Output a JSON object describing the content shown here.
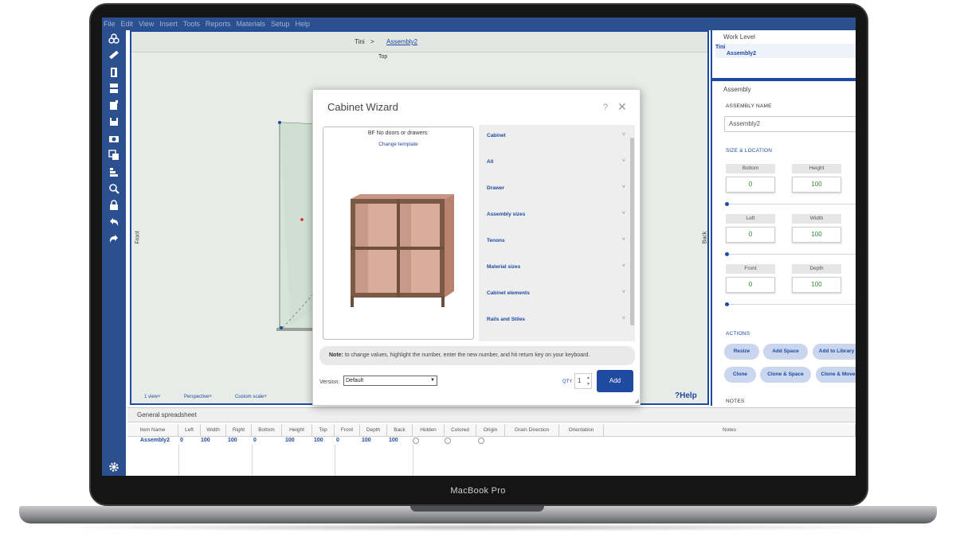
{
  "device": {
    "label": "MacBook Pro"
  },
  "menu": [
    "File",
    "Edit",
    "View",
    "Insert",
    "Tools",
    "Reports",
    "Materials",
    "Setup",
    "Help"
  ],
  "toolbar_icons": [
    "assembly-icon",
    "measure-icon",
    "door-icon",
    "drawer-icon",
    "panel-icon",
    "save-icon",
    "camera-icon",
    "copy-icon",
    "align-icon",
    "zoom-icon",
    "lock-icon",
    "undo-icon",
    "redo-icon"
  ],
  "settings_icon": "gear-icon",
  "viewport": {
    "breadcrumb_root": "Tini",
    "breadcrumb_sep": ">",
    "breadcrumb_current": "Assembly2",
    "top_label": "Top",
    "front_label": "Front",
    "back_label": "Back",
    "views": "1 view˅",
    "projection": "Perspective˅",
    "scale": "Custom scale˅",
    "help": "?Help"
  },
  "work_level": {
    "title": "Work Level",
    "root": "Tini",
    "child": "Assembly2"
  },
  "assembly": {
    "title": "Assembly",
    "name_label": "ASSEMBLY NAME",
    "name_value": "Assembly2",
    "size_label": "SIZE & LOCATION",
    "fields": [
      {
        "label": "Bottom",
        "value": "0"
      },
      {
        "label": "Height",
        "value": "100"
      },
      {
        "label": "Left",
        "value": "0"
      },
      {
        "label": "Width",
        "value": "100"
      },
      {
        "label": "Front",
        "value": "0"
      },
      {
        "label": "Depth",
        "value": "100"
      }
    ],
    "actions_label": "ACTIONS",
    "actions": [
      "Resize",
      "Add Space",
      "Add to Library",
      "Clone",
      "Clone & Space",
      "Clone & Move"
    ],
    "notes_label": "NOTES"
  },
  "dialog": {
    "title": "Cabinet Wizard",
    "help_glyph": "?",
    "close_glyph": "✕",
    "template_name": "BF No doors or drawers:",
    "change_template": "Change template",
    "categories": [
      "Cabinet",
      "All",
      "Drawer",
      "Assembly sizes",
      "Tenons",
      "Material sizes",
      "Cabinet elements",
      "Rails and Stiles"
    ],
    "note_bold": "Note:",
    "note_text": " to change values, highlight the number, enter the new number, and hit return key on your keyboard.",
    "version_label": "Version:",
    "version_value": "Default",
    "qty_label": "QTY",
    "qty_value": "1",
    "add_label": "Add"
  },
  "spreadsheet": {
    "tab": "General spreadsheet",
    "headers": [
      "Item Name",
      "Left",
      "Width",
      "Right",
      "Bottom",
      "Height",
      "Top",
      "Front",
      "Depth",
      "Back",
      "Hidden",
      "Colored",
      "Origin",
      "Grain Direction",
      "Orientation",
      "Notes"
    ],
    "row": {
      "name": "Assembly2",
      "left": "0",
      "width": "100",
      "right": "100",
      "bottom": "0",
      "height": "100",
      "top": "100",
      "front": "0",
      "depth": "100",
      "back": "100"
    }
  }
}
